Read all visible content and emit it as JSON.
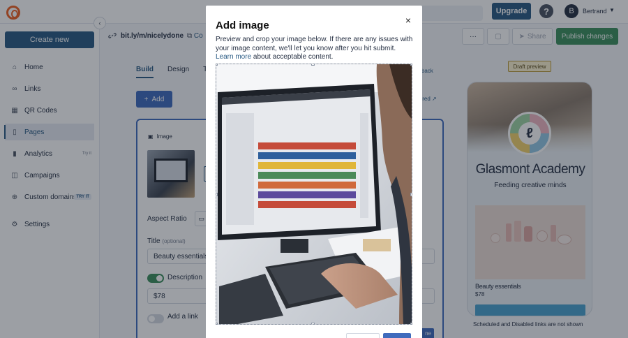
{
  "topbar": {
    "upgrade_label": "Upgrade",
    "help_label": "?",
    "avatar_initial": "B",
    "user_name": "Bertrand"
  },
  "sidebar": {
    "create_label": "Create new",
    "items": [
      {
        "label": "Home",
        "icon": "home-icon"
      },
      {
        "label": "Links",
        "icon": "link-icon"
      },
      {
        "label": "QR Codes",
        "icon": "qr-code-icon"
      },
      {
        "label": "Pages",
        "icon": "page-icon",
        "active": true
      },
      {
        "label": "Analytics",
        "icon": "analytics-icon",
        "tag": "Try it"
      },
      {
        "label": "Campaigns",
        "icon": "campaign-icon"
      },
      {
        "label": "Custom domains",
        "icon": "globe-icon",
        "tag": "TRY IT"
      },
      {
        "label": "Settings",
        "icon": "gear-icon"
      }
    ]
  },
  "header": {
    "url": "bit.ly/m/nicelydone",
    "copy_label": "Co",
    "more_label": "···",
    "share_label": "Share",
    "publish_label": "Publish changes"
  },
  "editor": {
    "tabs": [
      "Build",
      "Design",
      "Tr"
    ],
    "feedback_label": "edback",
    "add_label": "Add",
    "inspired_label": "spired",
    "card": {
      "type_label": "Image",
      "aspect_label": "Aspect Ratio",
      "title_label": "Title",
      "title_optional": "(optional)",
      "title_value": "Beauty essentials",
      "description_label": "Description",
      "description_value": "$78",
      "link_label": "Add a link",
      "done_label": "ne"
    }
  },
  "preview": {
    "badge": "Draft preview",
    "title": "Glasmont Academy",
    "subtitle": "Feeding creative minds",
    "item_title": "Beauty essentials",
    "item_price": "$78",
    "note": "Scheduled and Disabled links are not shown"
  },
  "modal": {
    "title": "Add image",
    "close_label": "×",
    "description": "Preview and crop your image below. If there are any issues with your image content, we'll let you know after you hit submit.",
    "learn_more": "Learn more",
    "description_tail": "about acceptable content."
  },
  "colors": {
    "brand": "#2a5b84",
    "accent_blue": "#3f6bbd",
    "publish_green": "#3d8f5e",
    "logo_orange": "#ee6123"
  }
}
